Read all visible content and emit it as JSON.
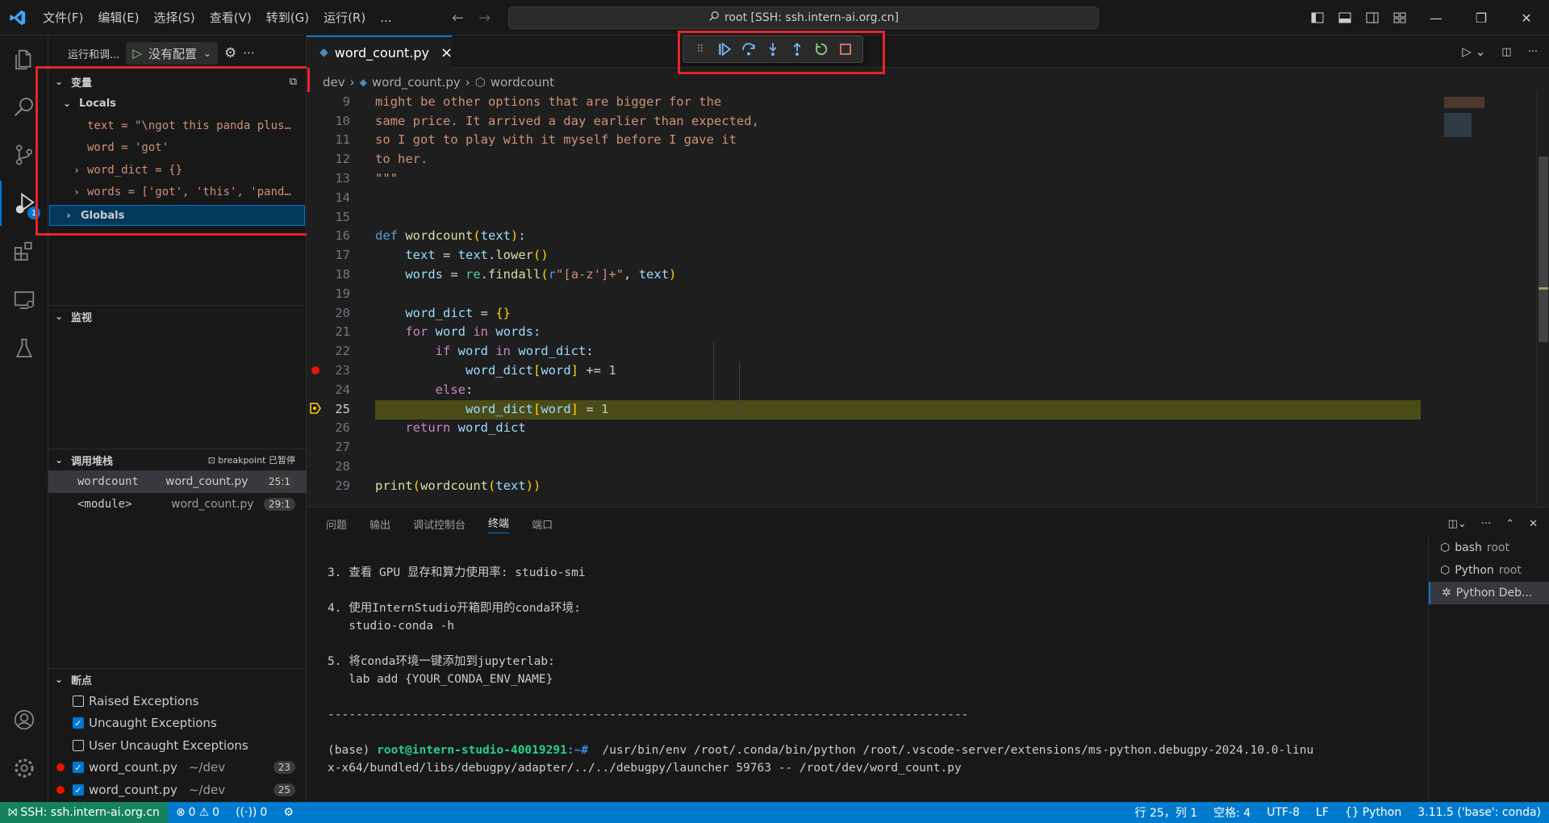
{
  "menus": [
    "文件(F)",
    "编辑(E)",
    "选择(S)",
    "查看(V)",
    "转到(G)",
    "运行(R)",
    "..."
  ],
  "command_center": "root [SSH: ssh.intern-ai.org.cn]",
  "sidebar": {
    "run_label": "运行和调...",
    "config_label": "没有配置",
    "variables_title": "变量",
    "locals_label": "Locals",
    "variables": [
      {
        "text": "text = \"\\ngot this panda plus…",
        "expandable": false
      },
      {
        "text": "word = 'got'",
        "expandable": false
      },
      {
        "text": "word_dict = {}",
        "expandable": true
      },
      {
        "text": "words = ['got', 'this', 'pand…",
        "expandable": true
      }
    ],
    "globals_label": "Globals",
    "watch_title": "监视",
    "callstack_title": "调用堆栈",
    "callstack_status": "breakpoint 已暂停",
    "callstack": [
      {
        "func": "wordcount",
        "file": "word_count.py",
        "pos": "25:1"
      },
      {
        "func": "<module>",
        "file": "word_count.py",
        "pos": "29:1"
      }
    ],
    "breakpoints_title": "断点",
    "breakpoints": [
      {
        "label": "Raised Exceptions",
        "checked": false,
        "dot": false,
        "path": "",
        "count": ""
      },
      {
        "label": "Uncaught Exceptions",
        "checked": true,
        "dot": false,
        "path": "",
        "count": ""
      },
      {
        "label": "User Uncaught Exceptions",
        "checked": false,
        "dot": false,
        "path": "",
        "count": ""
      },
      {
        "label": "word_count.py",
        "checked": true,
        "dot": true,
        "path": "~/dev",
        "count": "23"
      },
      {
        "label": "word_count.py",
        "checked": true,
        "dot": true,
        "path": "~/dev",
        "count": "25"
      }
    ]
  },
  "tab": {
    "label": "word_count.py",
    "close": "×"
  },
  "breadcrumb": {
    "folder": "dev",
    "file": "word_count.py",
    "symbol": "wordcount"
  },
  "panel": {
    "tabs": [
      "问题",
      "输出",
      "调试控制台",
      "终端",
      "端口"
    ],
    "active_tab": "终端",
    "terminal_lines": [
      "3. 查看 GPU 显存和算力使用率: studio-smi",
      "",
      "4. 使用InternStudio开箱即用的conda环境:",
      "   studio-conda -h",
      "",
      "5. 将conda环境一键添加到jupyterlab:",
      "   lab add {YOUR_CONDA_ENV_NAME}",
      "",
      "-------------------------------------------------------------------------------------------",
      "",
      "",
      "x-x64/bundled/libs/debugpy/adapter/../../debugpy/launcher 59763 -- /root/dev/word_count.py"
    ],
    "prompt_base": "(base) ",
    "prompt_user": "root@intern-studio-40019291",
    "prompt_path": ":~# ",
    "prompt_cmd": " /usr/bin/env /root/.conda/bin/python /root/.vscode-server/extensions/ms-python.debugpy-2024.10.0-linu",
    "terminals": [
      {
        "name": "bash",
        "owner": "root"
      },
      {
        "name": "Python",
        "owner": "root"
      },
      {
        "name": "Python Deb...",
        "owner": ""
      }
    ]
  },
  "status": {
    "remote": "SSH: ssh.intern-ai.org.cn",
    "errors": "0",
    "warnings": "0",
    "ports": "0",
    "position": "行 25，列 1",
    "spaces": "空格: 4",
    "encoding": "UTF-8",
    "eol": "LF",
    "language": "Python",
    "interpreter": "3.11.5 ('base': conda)"
  },
  "colors": {
    "accent": "#0078d4",
    "statusbar": "#007acc",
    "highlight": "#e5252c",
    "current_line": "#4b4b18"
  }
}
